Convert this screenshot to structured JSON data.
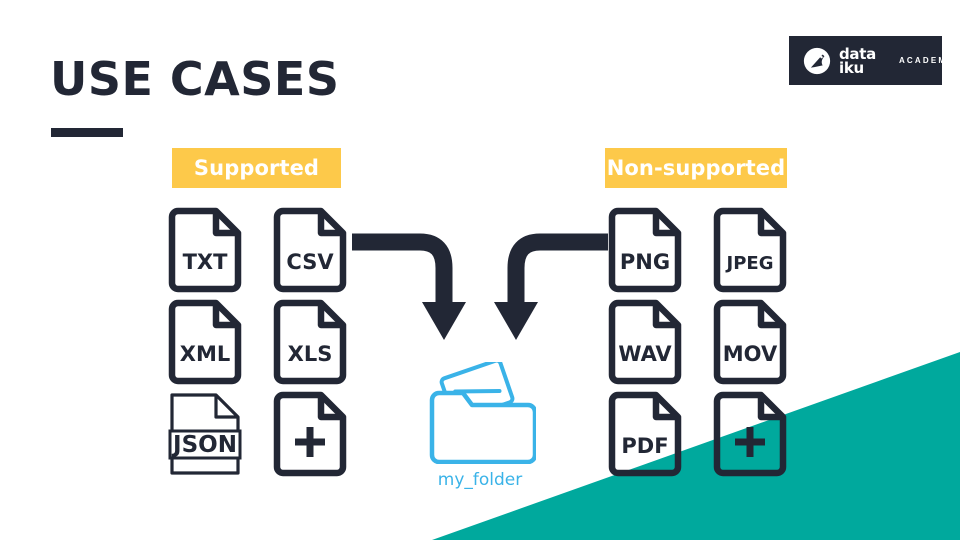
{
  "slide": {
    "title": "USE CASES",
    "background_color": "#FFFFFF"
  },
  "brand": {
    "logo_word_line1": "data",
    "logo_word_line2": "iku",
    "logo_secondary": "ACADEMY",
    "logo_background": "#222735",
    "accent_teal": "#00A99D",
    "accent_yellow": "#FDC94A",
    "accent_blue": "#3AB3E8",
    "ink": "#222735"
  },
  "badges": {
    "supported": "Supported",
    "non_supported": "Non-supported"
  },
  "supported_files": [
    {
      "label": "TXT",
      "style": "bold"
    },
    {
      "label": "CSV",
      "style": "bold"
    },
    {
      "label": "XML",
      "style": "bold"
    },
    {
      "label": "XLS",
      "style": "bold"
    },
    {
      "label": "JSON",
      "style": "thin-boxed"
    },
    {
      "label": "+",
      "style": "bold-plus"
    }
  ],
  "non_supported_files": [
    {
      "label": "PNG",
      "style": "bold"
    },
    {
      "label": "JPEG",
      "style": "bold"
    },
    {
      "label": "WAV",
      "style": "bold"
    },
    {
      "label": "MOV",
      "style": "bold"
    },
    {
      "label": "PDF",
      "style": "bold"
    },
    {
      "label": "+",
      "style": "bold-plus"
    }
  ],
  "folder": {
    "label": "my_folder",
    "icon": "folder-with-document-icon"
  },
  "arrows": [
    {
      "name": "arrow-supported-to-folder",
      "direction": "right-then-down"
    },
    {
      "name": "arrow-nonsupported-to-folder",
      "direction": "left-then-down"
    }
  ]
}
